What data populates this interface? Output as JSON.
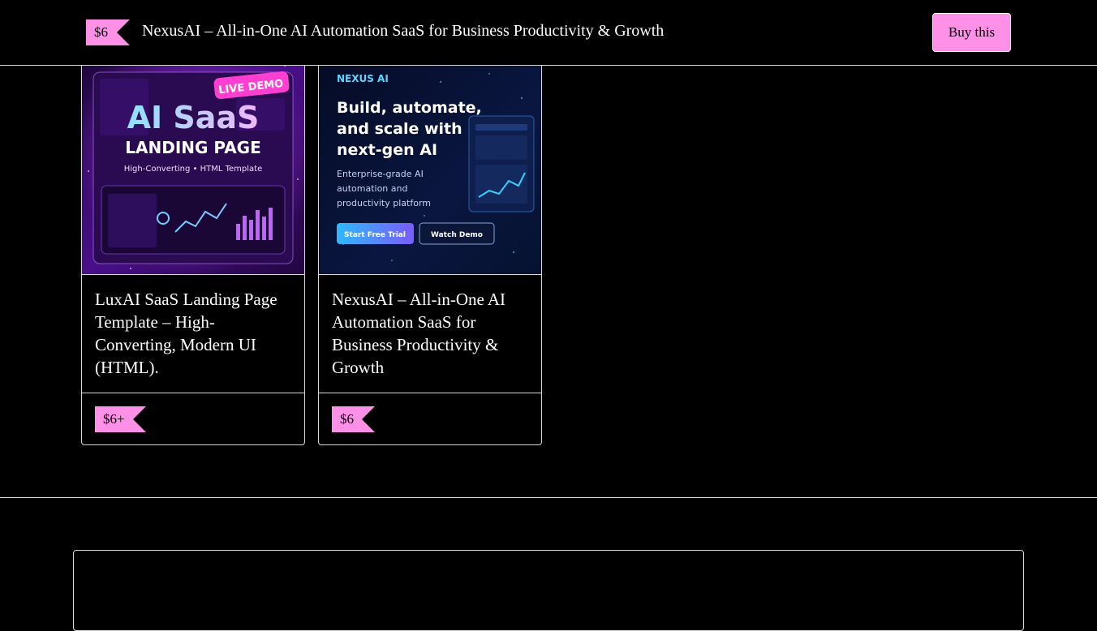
{
  "header": {
    "price": "$6",
    "title": "NexusAI – All-in-One AI Automation SaaS for Business Productivity & Growth",
    "buy_label": "Buy this"
  },
  "products": [
    {
      "title": "LuxAI SaaS Landing Page Template – High-Converting, Modern UI (HTML).",
      "price": "$6+",
      "thumbnail": {
        "badge": "LIVE DEMO",
        "headline": "AI SaaS",
        "subheadline": "LANDING PAGE",
        "caption": "High-Converting • HTML Template"
      }
    },
    {
      "title": "NexusAI – All-in-One AI Automation SaaS for Business Productivity & Growth",
      "price": "$6",
      "thumbnail": {
        "brand": "NEXUS AI",
        "headline_lines": [
          "Build, automate,",
          "and scale with",
          "next-gen AI"
        ],
        "body_lines": [
          "Enterprise-grade AI",
          "automation and",
          "productivity platform"
        ],
        "primary_button": "Start Free Trial",
        "secondary_button": "Watch Demo"
      }
    }
  ],
  "colors": {
    "accent": "#ff90e8",
    "background": "#000000",
    "border": "#d9d9d9"
  }
}
